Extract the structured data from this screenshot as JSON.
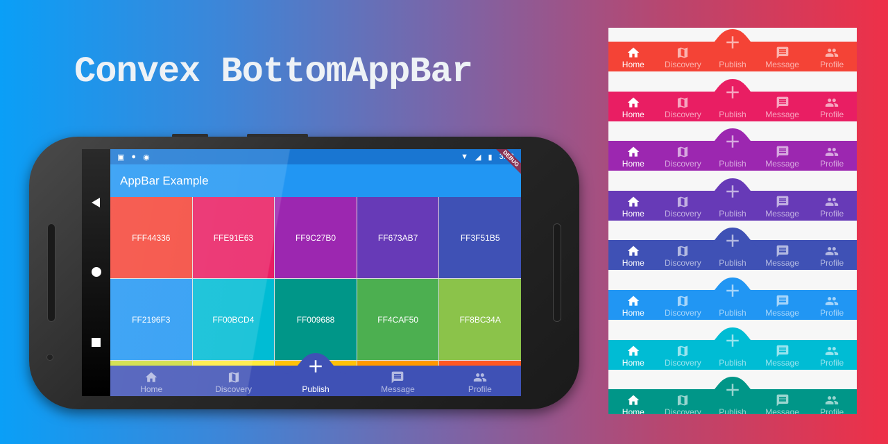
{
  "title": "Convex BottomAppBar",
  "phone": {
    "status_time": "3:46",
    "debug_banner": "DEBUG",
    "appbar_title": "AppBar Example",
    "grid": [
      "FFF44336",
      "FFE91E63",
      "FF9C27B0",
      "FF673AB7",
      "FF3F51B5",
      "FF2196F3",
      "FF00BCD4",
      "FF009688",
      "FF4CAF50",
      "FF8BC34A"
    ],
    "partial_row": [
      "#CDDC39",
      "#FFEB3B",
      "#FFC107",
      "#FF9800",
      "#FF5722"
    ],
    "nav_color": "#3F51B5",
    "active_index": 2
  },
  "nav_items": [
    {
      "label": "Home",
      "icon": "home-icon"
    },
    {
      "label": "Discovery",
      "icon": "map-icon"
    },
    {
      "label": "Publish",
      "icon": "add-icon"
    },
    {
      "label": "Message",
      "icon": "message-icon"
    },
    {
      "label": "Profile",
      "icon": "people-icon"
    }
  ],
  "panel": {
    "colors": [
      "#F44336",
      "#E91E63",
      "#9C27B0",
      "#673AB7",
      "#3F51B5",
      "#2196F3",
      "#00BCD4",
      "#009688"
    ],
    "active_index": 0
  }
}
